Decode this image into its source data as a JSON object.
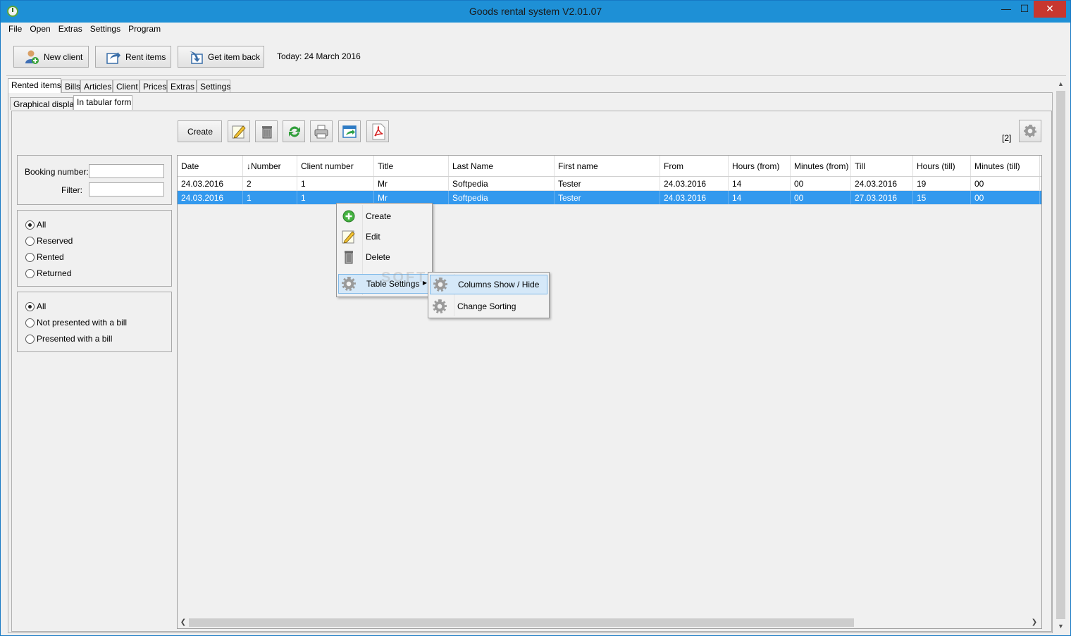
{
  "window": {
    "title": "Goods rental system V2.01.07",
    "minimize": "—",
    "maximize": "☐",
    "close": "✕"
  },
  "menu": [
    "File",
    "Open",
    "Extras",
    "Settings",
    "Program"
  ],
  "toolbar": {
    "new_client": "New client",
    "rent_items": "Rent items",
    "get_item_back": "Get item back",
    "today": "Today: 24 March 2016"
  },
  "main_tabs": [
    "Rented items",
    "Bills",
    "Articles",
    "Client",
    "Prices",
    "Extras",
    "Settings"
  ],
  "sub_tabs": [
    "Graphical display",
    "In tabular form"
  ],
  "actions": {
    "create": "Create",
    "count": "[2]"
  },
  "icons": [
    "edit-icon",
    "trash-icon",
    "refresh-icon",
    "printer-icon",
    "export-icon",
    "pdf-icon",
    "gear-icon"
  ],
  "filters": {
    "booking_label": "Booking number:",
    "booking_value": "",
    "filter_label": "Filter:",
    "filter_value": "",
    "status": [
      "All",
      "Reserved",
      "Rented",
      "Returned"
    ],
    "status_selected": 0,
    "bill": [
      "All",
      "Not presented with a bill",
      "Presented with a bill"
    ],
    "bill_selected": 0
  },
  "table": {
    "columns": [
      "Date",
      "Number",
      "Client number",
      "Title",
      "Last Name",
      "First name",
      "From",
      "Hours (from)",
      "Minutes (from)",
      "Till",
      "Hours (till)",
      "Minutes (till)"
    ],
    "sort_indicator": "↓",
    "rows": [
      [
        "24.03.2016",
        "2",
        "1",
        "Mr",
        "Softpedia",
        "Tester",
        "24.03.2016",
        "14",
        "00",
        "24.03.2016",
        "19",
        "00"
      ],
      [
        "24.03.2016",
        "1",
        "1",
        "Mr",
        "Softpedia",
        "Tester",
        "24.03.2016",
        "14",
        "00",
        "27.03.2016",
        "15",
        "00"
      ]
    ],
    "selected_row": 1,
    "selection_color": "#3399ee"
  },
  "context_menu": {
    "items": [
      "Create",
      "Edit",
      "Delete",
      "Table Settings"
    ],
    "submenu": [
      "Columns Show / Hide",
      "Change Sorting"
    ]
  },
  "watermark": "SOFTPEDIA"
}
